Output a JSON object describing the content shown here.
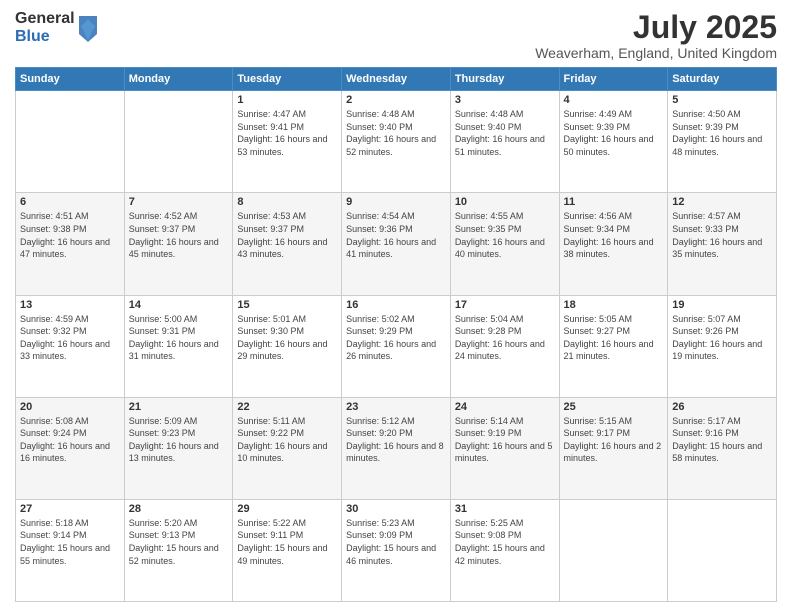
{
  "header": {
    "logo": {
      "general": "General",
      "blue": "Blue"
    },
    "title": "July 2025",
    "location": "Weaverham, England, United Kingdom"
  },
  "calendar": {
    "days": [
      "Sunday",
      "Monday",
      "Tuesday",
      "Wednesday",
      "Thursday",
      "Friday",
      "Saturday"
    ],
    "weeks": [
      [
        {
          "day": "",
          "content": ""
        },
        {
          "day": "",
          "content": ""
        },
        {
          "day": "1",
          "content": "Sunrise: 4:47 AM\nSunset: 9:41 PM\nDaylight: 16 hours and 53 minutes."
        },
        {
          "day": "2",
          "content": "Sunrise: 4:48 AM\nSunset: 9:40 PM\nDaylight: 16 hours and 52 minutes."
        },
        {
          "day": "3",
          "content": "Sunrise: 4:48 AM\nSunset: 9:40 PM\nDaylight: 16 hours and 51 minutes."
        },
        {
          "day": "4",
          "content": "Sunrise: 4:49 AM\nSunset: 9:39 PM\nDaylight: 16 hours and 50 minutes."
        },
        {
          "day": "5",
          "content": "Sunrise: 4:50 AM\nSunset: 9:39 PM\nDaylight: 16 hours and 48 minutes."
        }
      ],
      [
        {
          "day": "6",
          "content": "Sunrise: 4:51 AM\nSunset: 9:38 PM\nDaylight: 16 hours and 47 minutes."
        },
        {
          "day": "7",
          "content": "Sunrise: 4:52 AM\nSunset: 9:37 PM\nDaylight: 16 hours and 45 minutes."
        },
        {
          "day": "8",
          "content": "Sunrise: 4:53 AM\nSunset: 9:37 PM\nDaylight: 16 hours and 43 minutes."
        },
        {
          "day": "9",
          "content": "Sunrise: 4:54 AM\nSunset: 9:36 PM\nDaylight: 16 hours and 41 minutes."
        },
        {
          "day": "10",
          "content": "Sunrise: 4:55 AM\nSunset: 9:35 PM\nDaylight: 16 hours and 40 minutes."
        },
        {
          "day": "11",
          "content": "Sunrise: 4:56 AM\nSunset: 9:34 PM\nDaylight: 16 hours and 38 minutes."
        },
        {
          "day": "12",
          "content": "Sunrise: 4:57 AM\nSunset: 9:33 PM\nDaylight: 16 hours and 35 minutes."
        }
      ],
      [
        {
          "day": "13",
          "content": "Sunrise: 4:59 AM\nSunset: 9:32 PM\nDaylight: 16 hours and 33 minutes."
        },
        {
          "day": "14",
          "content": "Sunrise: 5:00 AM\nSunset: 9:31 PM\nDaylight: 16 hours and 31 minutes."
        },
        {
          "day": "15",
          "content": "Sunrise: 5:01 AM\nSunset: 9:30 PM\nDaylight: 16 hours and 29 minutes."
        },
        {
          "day": "16",
          "content": "Sunrise: 5:02 AM\nSunset: 9:29 PM\nDaylight: 16 hours and 26 minutes."
        },
        {
          "day": "17",
          "content": "Sunrise: 5:04 AM\nSunset: 9:28 PM\nDaylight: 16 hours and 24 minutes."
        },
        {
          "day": "18",
          "content": "Sunrise: 5:05 AM\nSunset: 9:27 PM\nDaylight: 16 hours and 21 minutes."
        },
        {
          "day": "19",
          "content": "Sunrise: 5:07 AM\nSunset: 9:26 PM\nDaylight: 16 hours and 19 minutes."
        }
      ],
      [
        {
          "day": "20",
          "content": "Sunrise: 5:08 AM\nSunset: 9:24 PM\nDaylight: 16 hours and 16 minutes."
        },
        {
          "day": "21",
          "content": "Sunrise: 5:09 AM\nSunset: 9:23 PM\nDaylight: 16 hours and 13 minutes."
        },
        {
          "day": "22",
          "content": "Sunrise: 5:11 AM\nSunset: 9:22 PM\nDaylight: 16 hours and 10 minutes."
        },
        {
          "day": "23",
          "content": "Sunrise: 5:12 AM\nSunset: 9:20 PM\nDaylight: 16 hours and 8 minutes."
        },
        {
          "day": "24",
          "content": "Sunrise: 5:14 AM\nSunset: 9:19 PM\nDaylight: 16 hours and 5 minutes."
        },
        {
          "day": "25",
          "content": "Sunrise: 5:15 AM\nSunset: 9:17 PM\nDaylight: 16 hours and 2 minutes."
        },
        {
          "day": "26",
          "content": "Sunrise: 5:17 AM\nSunset: 9:16 PM\nDaylight: 15 hours and 58 minutes."
        }
      ],
      [
        {
          "day": "27",
          "content": "Sunrise: 5:18 AM\nSunset: 9:14 PM\nDaylight: 15 hours and 55 minutes."
        },
        {
          "day": "28",
          "content": "Sunrise: 5:20 AM\nSunset: 9:13 PM\nDaylight: 15 hours and 52 minutes."
        },
        {
          "day": "29",
          "content": "Sunrise: 5:22 AM\nSunset: 9:11 PM\nDaylight: 15 hours and 49 minutes."
        },
        {
          "day": "30",
          "content": "Sunrise: 5:23 AM\nSunset: 9:09 PM\nDaylight: 15 hours and 46 minutes."
        },
        {
          "day": "31",
          "content": "Sunrise: 5:25 AM\nSunset: 9:08 PM\nDaylight: 15 hours and 42 minutes."
        },
        {
          "day": "",
          "content": ""
        },
        {
          "day": "",
          "content": ""
        }
      ]
    ]
  }
}
